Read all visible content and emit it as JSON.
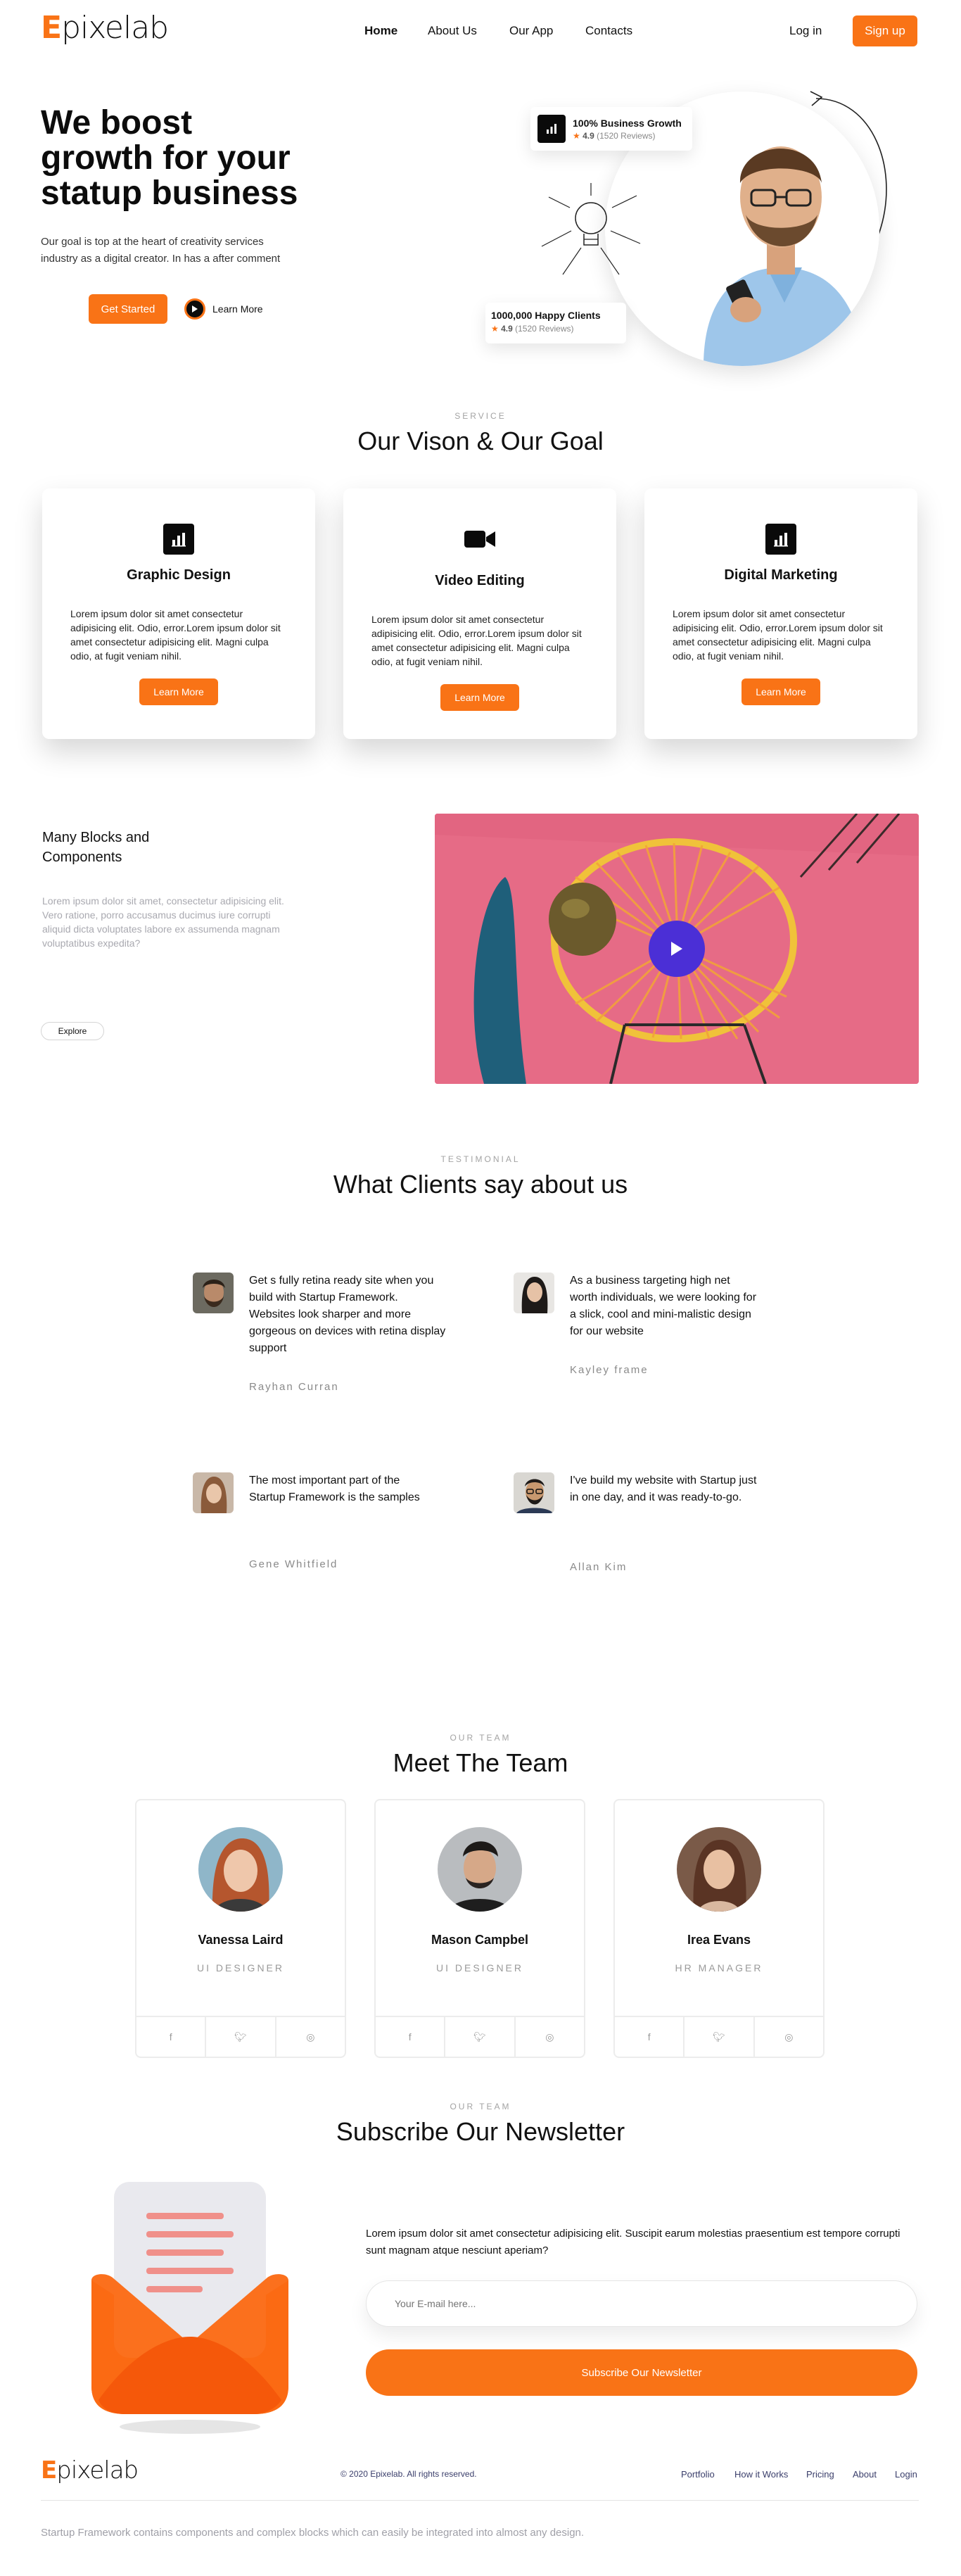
{
  "brand": {
    "logo_mark": "E",
    "logo_text": "pixelab"
  },
  "nav": {
    "items": [
      "Home",
      "About Us",
      "Our App",
      "Contacts"
    ],
    "login": "Log in",
    "signup": "Sign up"
  },
  "hero": {
    "title_line1": "We boost",
    "title_line2": "growth for your",
    "title_line3": "statup business",
    "subtitle_line1": "Our goal is top at the heart of creativity services",
    "subtitle_line2": "industry as a digital creator. In has a after comment",
    "cta_primary": "Get Started",
    "cta_secondary": "Learn More",
    "badge_growth": {
      "title": "100% Business Growth",
      "rating": "4.9",
      "reviews": "(1520 Reviews)"
    },
    "badge_clients": {
      "title": "1000,000 Happy Clients",
      "rating": "4.9",
      "reviews": "(1520 Reviews)"
    }
  },
  "services": {
    "eyebrow": "SERVICE",
    "title": "Our Vison & Our Goal",
    "cards": [
      {
        "title": "Graphic Design",
        "icon": "bar-chart-icon",
        "text": "Lorem ipsum dolor sit amet consectetur adipisicing elit. Odio, error.Lorem ipsum dolor sit amet consectetur adipisicing elit. Magni culpa odio, at fugit veniam nihil.",
        "button": "Learn More"
      },
      {
        "title": "Video Editing",
        "icon": "video-camera-icon",
        "text": "Lorem ipsum dolor sit amet consectetur adipisicing elit. Odio, error.Lorem ipsum dolor sit amet consectetur adipisicing elit. Magni culpa odio, at fugit veniam nihil.",
        "button": "Learn More"
      },
      {
        "title": "Digital Marketing",
        "icon": "bar-chart-icon",
        "text": "Lorem ipsum dolor sit amet consectetur adipisicing elit. Odio, error.Lorem ipsum dolor sit amet consectetur adipisicing elit. Magni culpa odio, at fugit veniam nihil.",
        "button": "Learn More"
      }
    ]
  },
  "blocks": {
    "title_line1": "Many Blocks and",
    "title_line2": "Components",
    "text": "Lorem ipsum dolor sit amet, consectetur adipisicing elit. Vero ratione, porro accusamus ducimus iure corrupti aliquid dicta voluptates labore ex assumenda magnam voluptatibus expedita?",
    "button": "Explore"
  },
  "testimonials": {
    "eyebrow": "TESTIMONIAL",
    "title": "What Clients say about us",
    "items": [
      {
        "text": "Get s fully retina ready site when you build with Startup Framework. Websites look sharper and more gorgeous on devices with retina display support",
        "name": "Rayhan Curran"
      },
      {
        "text": "As a business targeting high net worth individuals, we were looking for a slick, cool and mini-malistic design for our website",
        "name": "Kayley frame"
      },
      {
        "text": "The most important part of the Startup Framework is the samples",
        "name": "Gene Whitfield"
      },
      {
        "text": "I've build my website with Startup just in one day, and it was ready-to-go.",
        "name": "Allan Kim"
      }
    ]
  },
  "team": {
    "eyebrow": "OUR TEAM",
    "title": "Meet The Team",
    "members": [
      {
        "name": "Vanessa Laird",
        "role": "UI DESIGNER"
      },
      {
        "name": "Mason Campbel",
        "role": "UI DESIGNER"
      },
      {
        "name": "Irea Evans",
        "role": "HR MANAGER"
      }
    ]
  },
  "newsletter": {
    "eyebrow": "OUR TEAM",
    "title": "Subscribe Our Newsletter",
    "text": "Lorem ipsum dolor sit amet consectetur adipisicing elit. Suscipit earum molestias praesentium est tempore corrupti sunt magnam atque nesciunt aperiam?",
    "placeholder": "Your E-mail here...",
    "button": "Subscribe Our Newsletter"
  },
  "footer": {
    "copyright": "© 2020 Epixelab. All rights reserved.",
    "links": [
      "Portfolio",
      "How it Works",
      "Pricing",
      "About",
      "Login"
    ],
    "bottom_text": "Startup Framework contains components and complex blocks which can easily be integrated into almost any design."
  },
  "colors": {
    "accent": "#f97316",
    "play": "#4b2fd6",
    "pink": "#e66b86"
  }
}
